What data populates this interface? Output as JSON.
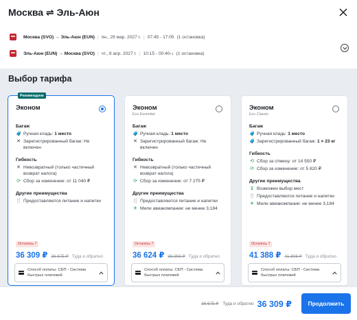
{
  "header": {
    "title": "Москва ⇌ Эль-Аюн"
  },
  "flights": [
    {
      "route": "Москва (SVO) → Эль-Аюн (EUN)",
      "date": "пн., 29 мар. 2027 г.",
      "time": "07:45 - 17:05",
      "stops": "(1 остановка)"
    },
    {
      "route": "Эль-Аюн (EUN) → Москва (SVO)",
      "date": "чт., 8 апр. 2027 г.",
      "time": "10:15 - 00:40",
      "time_sup": "+1",
      "stops": "(1 остановка)"
    }
  ],
  "section_title": "Выбор тарифа",
  "cards": [
    {
      "badge": "Рекомендуем",
      "name": "Эконом",
      "sub": "",
      "selected": true,
      "baggage_title": "Багаж",
      "hand_prefix": "Ручная кладь: ",
      "hand_value": "1 место",
      "checked": "Зарегистрированный багаж: Не включен",
      "flex_title": "Гибкость",
      "refund": "Невозвратный (только частичный возврат налога)",
      "change": "Сбор за изменение: от 11 040 ₽",
      "other_title": "Другие преимущества",
      "other": [
        "Предоставляются питание и напитки"
      ],
      "left": "Осталось 7",
      "price": "36 309 ₽",
      "old_price": "36 675 ₽",
      "price_note": "Туда и обратно",
      "pay": "Способ оплаты: СБП - Система быстрых платежей"
    },
    {
      "name": "Эконом",
      "sub": "Eco Essential",
      "selected": false,
      "baggage_title": "Багаж",
      "hand_prefix": "Ручная кладь: ",
      "hand_value": "1 место",
      "checked": "Зарегистрированный багаж: Не включен",
      "flex_title": "Гибкость",
      "refund": "Невозвратный (только частичный возврат налога)",
      "change": "Сбор за изменение: от 7 275 ₽",
      "other_title": "Другие преимущества",
      "other": [
        "Предоставляются питание и напитки",
        "Мили авиакомпании: не менее 3,184"
      ],
      "left": "Осталось 7",
      "price": "36 624 ₽",
      "old_price": "36 993 ₽",
      "price_note": "Туда и обратно",
      "pay": "Способ оплаты: СБП - Система быстрых платежей"
    },
    {
      "name": "Эконом",
      "sub": "Eco Classic",
      "selected": false,
      "baggage_title": "Багаж",
      "hand_prefix": "Ручная кладь: ",
      "hand_value": "1 место",
      "checked_prefix": "Зарегистрированный багаж: ",
      "checked_value": "1 × 23 кг",
      "flex_title": "Гибкость",
      "refund_fee": "Сбор за отмену: от 14 550 ₽",
      "change": "Сбор за изменение: от 5 820 ₽",
      "other_title": "Другие преимущества",
      "other": [
        "Возможен выбор мест",
        "Предоставляются питание и напитки",
        "Мили авиакомпании: не менее 3,184"
      ],
      "left": "Осталось 7",
      "price": "41 388 ₽",
      "old_price": "41 806 ₽",
      "price_note": "Туда и обратно",
      "pay": "Способ оплаты: СБП - Система быстрых платежей"
    }
  ],
  "footer": {
    "old_price": "36 675 ₽",
    "note": "Туда и обратно",
    "price": "36 309 ₽",
    "button": "Продолжить"
  },
  "colors": {
    "accent": "#1a73e8",
    "badge": "#006a6a",
    "airline": "#c3273b"
  }
}
